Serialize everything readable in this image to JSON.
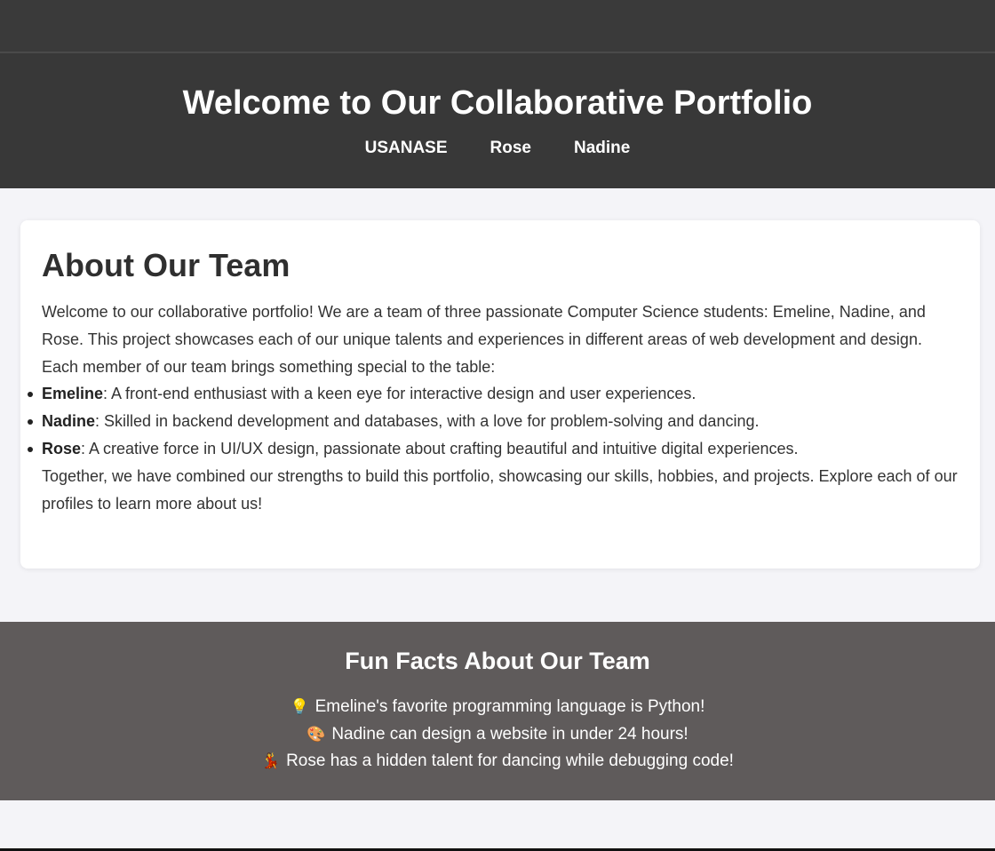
{
  "header": {
    "title": "Welcome to Our Collaborative Portfolio",
    "nav": [
      {
        "label": "USANASE"
      },
      {
        "label": "Rose"
      },
      {
        "label": "Nadine"
      }
    ]
  },
  "about": {
    "heading": "About Our Team",
    "intro": "Welcome to our collaborative portfolio! We are a team of three passionate Computer Science students: Emeline, Nadine, and Rose. This project showcases each of our unique talents and experiences in different areas of web development and design.",
    "lead": "Each member of our team brings something special to the table:",
    "members": [
      {
        "name": "Emeline",
        "desc": ": A front-end enthusiast with a keen eye for interactive design and user experiences."
      },
      {
        "name": "Nadine",
        "desc": ": Skilled in backend development and databases, with a love for problem-solving and dancing."
      },
      {
        "name": "Rose",
        "desc": ": A creative force in UI/UX design, passionate about crafting beautiful and intuitive digital experiences."
      }
    ],
    "closing": "Together, we have combined our strengths to build this portfolio, showcasing our skills, hobbies, and projects. Explore each of our profiles to learn more about us!"
  },
  "facts": {
    "heading": "Fun Facts About Our Team",
    "items": [
      {
        "icon": "lightbulb-icon",
        "glyph": "💡",
        "text": "Emeline's favorite programming language is Python!"
      },
      {
        "icon": "palette-icon",
        "glyph": "🎨",
        "text": "Nadine can design a website in under 24 hours!"
      },
      {
        "icon": "dancer-icon",
        "glyph": "💃",
        "text": "Rose has a hidden talent for dancing while debugging code!"
      }
    ]
  },
  "colors": {
    "header_bg": "#383838",
    "page_bg": "#f4f4f8",
    "facts_bg": "#5f5b5b",
    "card_bg": "#ffffff"
  }
}
